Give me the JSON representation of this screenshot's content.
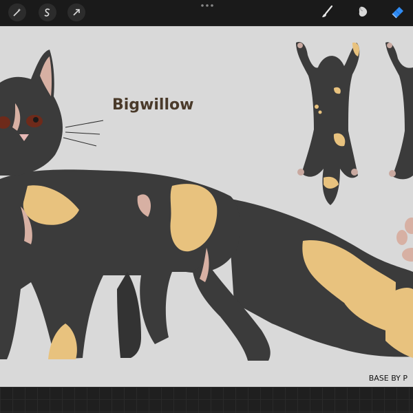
{
  "toolbar": {
    "left_tools": [
      "adjustments-wand-icon",
      "selection-s-icon",
      "transform-arrow-icon"
    ],
    "menu_icon": "more-dots-icon",
    "right_tools": [
      "brush-icon",
      "smudge-icon",
      "eraser-icon"
    ],
    "active_tool": "eraser-icon",
    "active_color": "#2f8cf5"
  },
  "canvas": {
    "title": "Bigwillow",
    "credit": "BASE BY P"
  },
  "colors": {
    "background": "#d9d9d9",
    "fur_dark": "#3b3b3b",
    "fur_patch": "#e8c27e",
    "scar_pink": "#d7b0a3",
    "title_brown": "#4a3a2a"
  }
}
